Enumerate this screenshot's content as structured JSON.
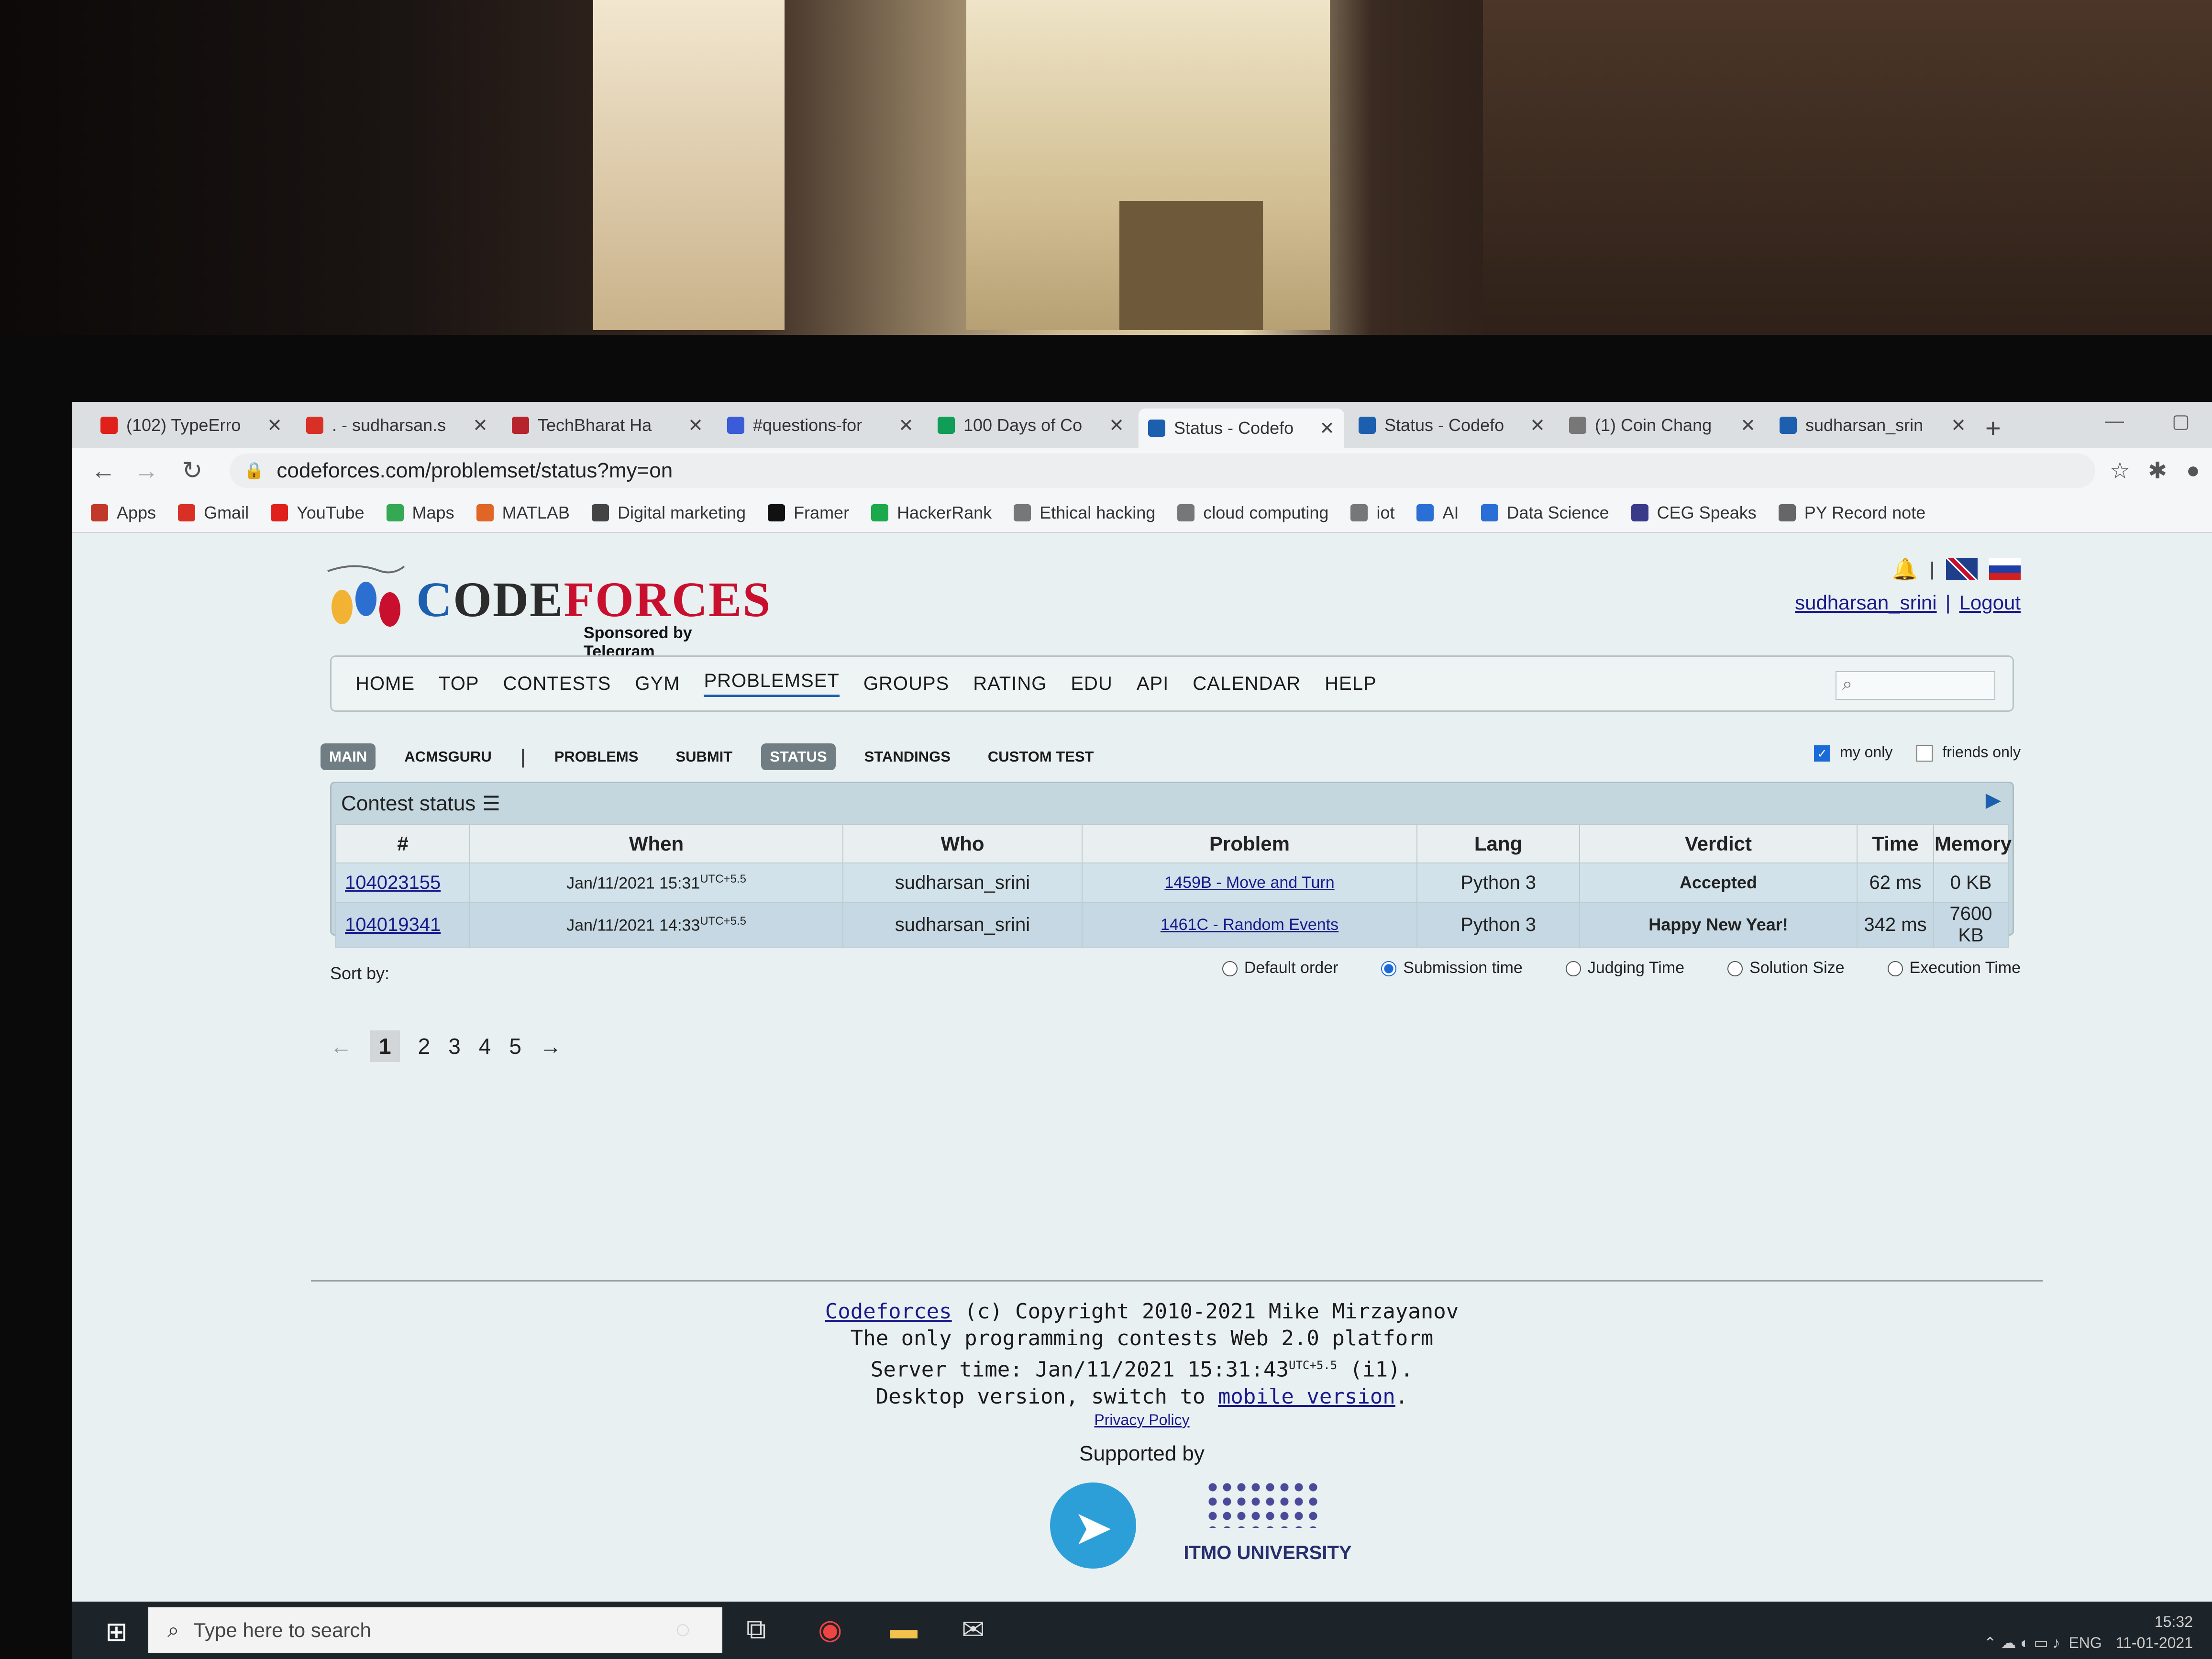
{
  "tabs": [
    {
      "label": "(102) TypeErro",
      "color": "#e0201b"
    },
    {
      "label": ". - sudharsan.s",
      "color": "#d93025"
    },
    {
      "label": "TechBharat Ha",
      "color": "#b8242b"
    },
    {
      "label": "#questions-for",
      "color": "#3b5bd8"
    },
    {
      "label": "100 Days of Co",
      "color": "#0f9d58"
    },
    {
      "label": "Status - Codefo",
      "color": "#1b5fae"
    },
    {
      "label": "Status - Codefo",
      "color": "#1b5fae"
    },
    {
      "label": "(1) Coin Chang",
      "color": "#777777"
    },
    {
      "label": "sudharsan_srin",
      "color": "#1b5fae"
    }
  ],
  "address": {
    "url": "codeforces.com/problemset/status?my=on"
  },
  "bookmarks": [
    {
      "label": "Apps",
      "color": "#c0392b"
    },
    {
      "label": "Gmail",
      "color": "#d93025"
    },
    {
      "label": "YouTube",
      "color": "#e0201b"
    },
    {
      "label": "Maps",
      "color": "#34a853"
    },
    {
      "label": "MATLAB",
      "color": "#e16526"
    },
    {
      "label": "Digital marketing",
      "color": "#444444"
    },
    {
      "label": "Framer",
      "color": "#111111"
    },
    {
      "label": "HackerRank",
      "color": "#1ba94c"
    },
    {
      "label": "Ethical hacking",
      "color": "#777777"
    },
    {
      "label": "cloud computing",
      "color": "#777777"
    },
    {
      "label": "iot",
      "color": "#777777"
    },
    {
      "label": "AI",
      "color": "#2a6fd6"
    },
    {
      "label": "Data Science",
      "color": "#2a6fd6"
    },
    {
      "label": "CEG Speaks",
      "color": "#3a3a8a"
    },
    {
      "label": "PY Record note",
      "color": "#666666"
    }
  ],
  "logo": {
    "word_c": "C",
    "word_rest": "ODE",
    "word_f": "FORCES",
    "sponsor": "Sponsored by Telegram"
  },
  "user": {
    "name": "sudharsan_srini",
    "sep": "|",
    "logout": "Logout"
  },
  "menu": [
    "HOME",
    "TOP",
    "CONTESTS",
    "GYM",
    "PROBLEMSET",
    "GROUPS",
    "RATING",
    "EDU",
    "API",
    "CALENDAR",
    "HELP"
  ],
  "menu_selected": "PROBLEMSET",
  "submenu": [
    "MAIN",
    "ACMSGURU",
    "PROBLEMS",
    "SUBMIT",
    "STATUS",
    "STANDINGS",
    "CUSTOM TEST"
  ],
  "filters": {
    "my_only": "my only",
    "friends_only": "friends only"
  },
  "status": {
    "title": "Contest status",
    "headers": [
      "#",
      "When",
      "Who",
      "Problem",
      "Lang",
      "Verdict",
      "Time",
      "Memory"
    ],
    "rows": [
      {
        "id": "104023155",
        "when": "Jan/11/2021 15:31",
        "utc": "UTC+5.5",
        "who": "sudharsan_srini",
        "problem": "1459B - Move and Turn",
        "lang": "Python 3",
        "verdict": "Accepted",
        "time": "62 ms",
        "memory": "0 KB"
      },
      {
        "id": "104019341",
        "when": "Jan/11/2021 14:33",
        "utc": "UTC+5.5",
        "who": "sudharsan_srini",
        "problem": "1461C - Random Events",
        "lang": "Python 3",
        "verdict": "Happy New Year!",
        "time": "342 ms",
        "memory": "7600 KB"
      }
    ]
  },
  "sort": {
    "label": "Sort by:",
    "options": [
      "Default order",
      "Submission time",
      "Judging Time",
      "Solution Size",
      "Execution Time"
    ],
    "selected": "Submission time"
  },
  "pager": {
    "prev": "←",
    "pages": [
      "1",
      "2",
      "3",
      "4",
      "5"
    ],
    "current": "1",
    "next": "→"
  },
  "footer": {
    "cf_link": "Codeforces",
    "copyright": " (c) Copyright 2010-2021 Mike Mirzayanov",
    "tagline": "The only programming contests Web 2.0 platform",
    "server_time_prefix": "Server time: Jan/11/2021 15:31:43",
    "server_utc": "UTC+5.5",
    "server_suffix": " (i1).",
    "desktop_prefix": "Desktop version, switch to ",
    "mobile_link": "mobile version",
    "desktop_suffix": ".",
    "privacy": "Privacy Policy",
    "supported_by": "Supported by",
    "itmo": "ITMO UNIVERSITY"
  },
  "taskbar": {
    "search_placeholder": "Type here to search",
    "lang": "ENG",
    "time": "15:32",
    "date": "11-01-2021"
  }
}
